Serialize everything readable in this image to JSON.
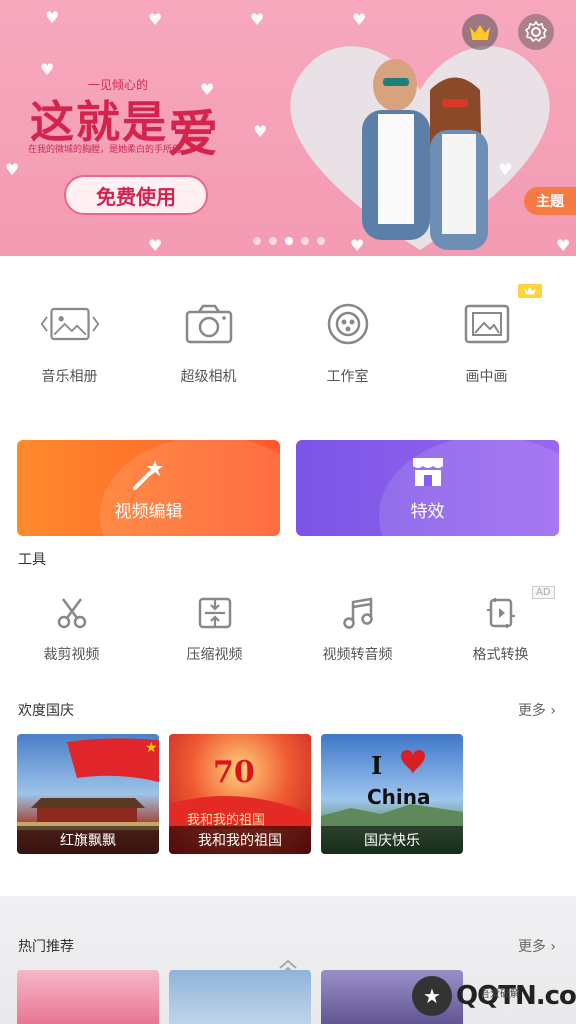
{
  "banner": {
    "sub_top": "一见倾心的",
    "title_main": "这就是",
    "title_ai": "爱",
    "desc": "在我的微城的胸膛，是她柔白的手所倚。",
    "free_button": "免费使用",
    "theme_tag": "主题",
    "crown_icon": "crown-icon",
    "settings_icon": "gear-icon"
  },
  "features": [
    {
      "label": "音乐相册",
      "icon": "photo-slideshow-icon"
    },
    {
      "label": "超级相机",
      "icon": "camera-icon"
    },
    {
      "label": "工作室",
      "icon": "studio-reel-icon"
    },
    {
      "label": "画中画",
      "icon": "picture-in-picture-icon"
    }
  ],
  "big_buttons": {
    "edit": "视频编辑",
    "fx": "特效"
  },
  "tools": {
    "title": "工具",
    "items": [
      {
        "label": "裁剪视频",
        "icon": "scissors-icon"
      },
      {
        "label": "压缩视频",
        "icon": "compress-icon"
      },
      {
        "label": "视频转音频",
        "icon": "music-note-icon"
      },
      {
        "label": "格式转换",
        "icon": "format-convert-icon"
      }
    ],
    "ad": "AD"
  },
  "national_day": {
    "title": "欢度国庆",
    "more": "更多",
    "cards": [
      "红旗飘飘",
      "我和我的祖国",
      "国庆快乐"
    ],
    "card3_overlay": "I China"
  },
  "hot": {
    "title": "热门推荐",
    "more": "更多"
  },
  "watermark": {
    "text": "QQTN.com",
    "small": "吾爱破解"
  },
  "colors": {
    "banner": "#f39bb3",
    "edit_orange": "#ff6a2a",
    "fx_purple": "#8a5df0",
    "theme_orange": "#f57a43"
  }
}
